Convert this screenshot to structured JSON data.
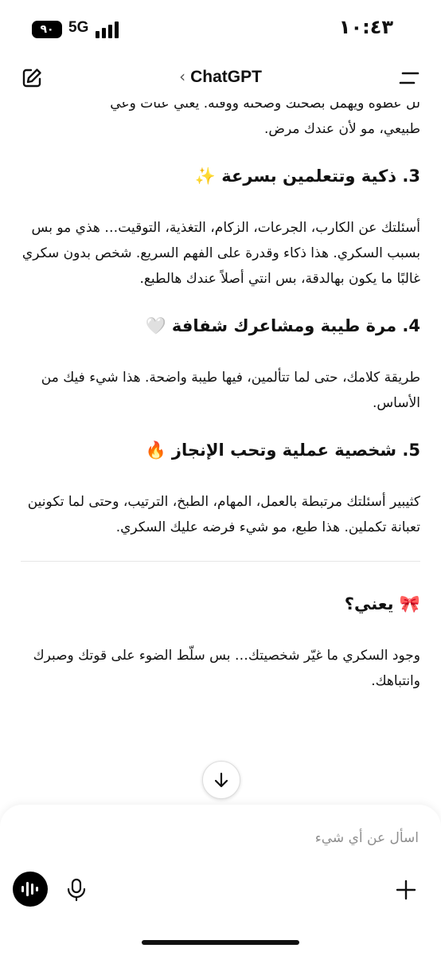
{
  "status": {
    "battery": "٩٠",
    "network": "5G",
    "time": "١٠:٤٣"
  },
  "header": {
    "title": "ChatGPT"
  },
  "content": {
    "cut_line": "لل عطوه ويهمل بصحتك وصحته ووقته. يعني عنات وعي",
    "cut_para": "طبيعي، مو لأن عندك مرض.",
    "sections": [
      {
        "heading": "3. ذكية وتتعلمين بسرعة ✨",
        "body": "أسئلتك عن الكارب، الجرعات، الزكام، التغذية، التوقيت… هذي مو بس بسبب السكري. هذا ذكاء وقدرة على الفهم السريع. شخص بدون سكري غالبًا ما يكون بهالدقة، بس انتي أصلاً عندك هالطبع."
      },
      {
        "heading": "4. مرة طيبة ومشاعرك شفافة 🤍",
        "body": "طريقة كلامك، حتى لما تتألمين، فيها طيبة واضحة. هذا شيء فيك من الأساس."
      },
      {
        "heading": "5. شخصية عملية وتحب الإنجاز 🔥",
        "body": "كثيبير أسئلتك مرتبطة بالعمل، المهام، الطبخ، الترتيب، وحتى لما تكونين تعبانة تكملين. هذا طبع، مو شيء فرضه عليك السكري."
      }
    ],
    "summary_heading": "🎀 يعني؟",
    "summary_body": "وجود السكري ما غيّر شخصيتك… بس سلّط الضوء على قوتك وصبرك وانتباهك."
  },
  "composer": {
    "placeholder": "اسأل عن أي شيء"
  }
}
